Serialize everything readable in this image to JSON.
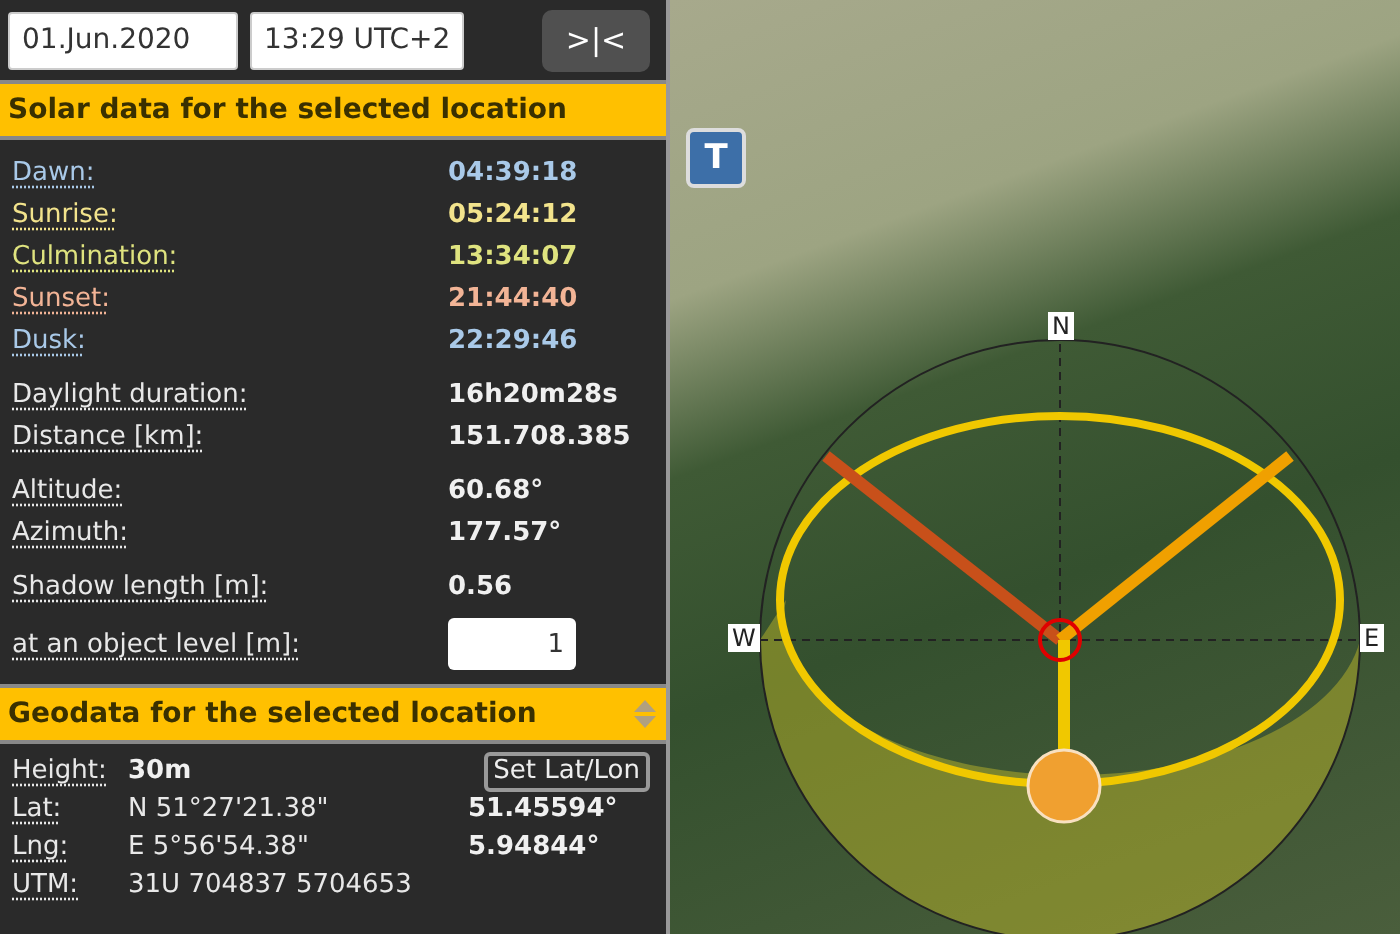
{
  "date_field": {
    "value": "01.Jun.2020"
  },
  "time_field": {
    "value": "13:29 UTC+2"
  },
  "collapse_button": {
    "label": ">|<"
  },
  "solar": {
    "title": "Solar data for the selected location",
    "times": [
      {
        "label": "Dawn:",
        "value": "04:39:18",
        "color": "#a9c9e8"
      },
      {
        "label": "Sunrise:",
        "value": "05:24:12",
        "color": "#f2e38c"
      },
      {
        "label": "Culmination:",
        "value": "13:34:07",
        "color": "#dfe37f"
      },
      {
        "label": "Sunset:",
        "value": "21:44:40",
        "color": "#f2b496"
      },
      {
        "label": "Dusk:",
        "value": "22:29:46",
        "color": "#a9c9e8"
      }
    ],
    "groups": [
      [
        {
          "label": "Daylight duration:",
          "value": "16h20m28s"
        },
        {
          "label": "Distance [km]:",
          "value": "151.708.385"
        }
      ],
      [
        {
          "label": "Altitude:",
          "value": "60.68°"
        },
        {
          "label": "Azimuth:",
          "value": "177.57°"
        }
      ],
      [
        {
          "label": "Shadow length [m]:",
          "value": "0.56"
        }
      ]
    ],
    "object_level": {
      "label": "at an object level [m]:",
      "value": "1"
    }
  },
  "geodata": {
    "title": "Geodata for the selected location",
    "expanded": true,
    "height": {
      "label": "Height:",
      "value": "30m"
    },
    "set_button": {
      "label": "Set Lat/Lon"
    },
    "coords": [
      {
        "label": "Lat:",
        "dms": "N 51°27'21.38\"",
        "decimal": "51.45594°"
      },
      {
        "label": "Lng:",
        "dms": "E 5°56'54.38\"",
        "decimal": "5.94844°"
      }
    ],
    "utm": {
      "label": "UTM:",
      "value": "31U 704837 5704653"
    }
  },
  "map": {
    "layer_button": {
      "label": "T"
    },
    "compass": {
      "north": "N",
      "west": "W",
      "east": "E"
    }
  }
}
